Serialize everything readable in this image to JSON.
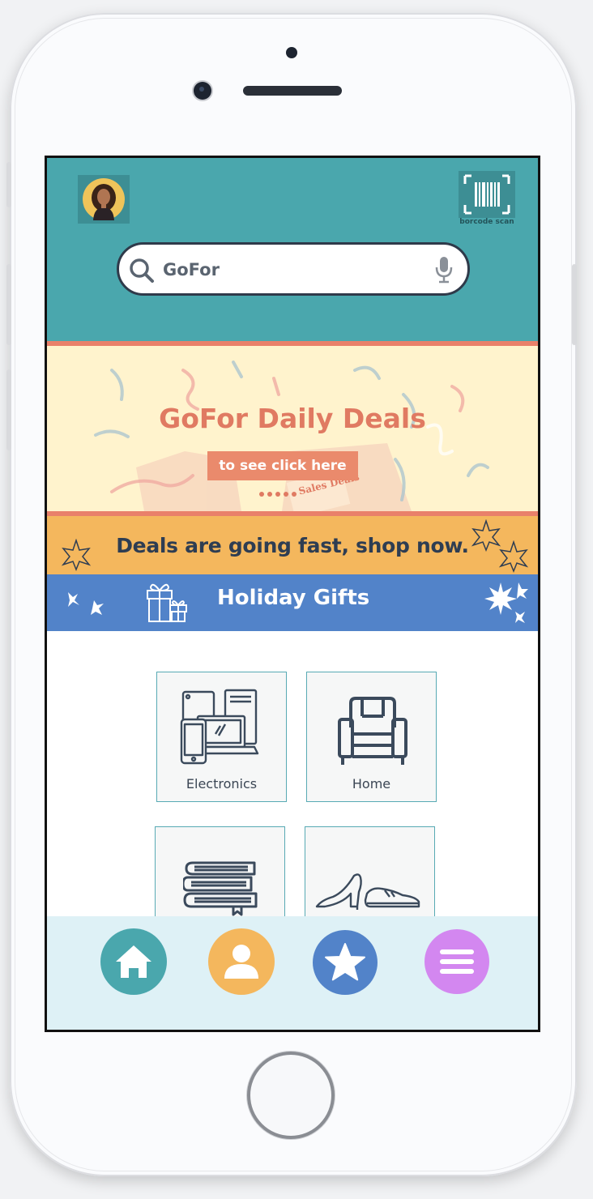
{
  "header": {
    "barcode_label": "borcode scan"
  },
  "search": {
    "value": "GoFor"
  },
  "banner": {
    "title": "GoFor Daily Deals",
    "button_label": "to see click here",
    "box_text": "Sales Deals"
  },
  "deals_strip": {
    "text": "Deals are going fast, shop now."
  },
  "holiday": {
    "title": "Holiday Gifts"
  },
  "categories": [
    {
      "label": "Electronics",
      "icon": "electronics-icon"
    },
    {
      "label": "Home",
      "icon": "armchair-icon"
    },
    {
      "label": "",
      "icon": "books-icon"
    },
    {
      "label": "",
      "icon": "shoes-icon"
    }
  ],
  "nav": {
    "items": [
      {
        "icon": "home-icon",
        "color": "#4aa7ad"
      },
      {
        "icon": "profile-icon",
        "color": "#f4b75d"
      },
      {
        "icon": "star-icon",
        "color": "#5283c9"
      },
      {
        "icon": "menu-icon",
        "color": "#d387f0"
      }
    ]
  },
  "colors": {
    "teal": "#4aa7ad",
    "coral": "#e9806a",
    "cream": "#fff3cd",
    "amber": "#f4b75d",
    "blue": "#5283c9",
    "purple": "#d387f0",
    "nav_bg": "#def1f6"
  }
}
